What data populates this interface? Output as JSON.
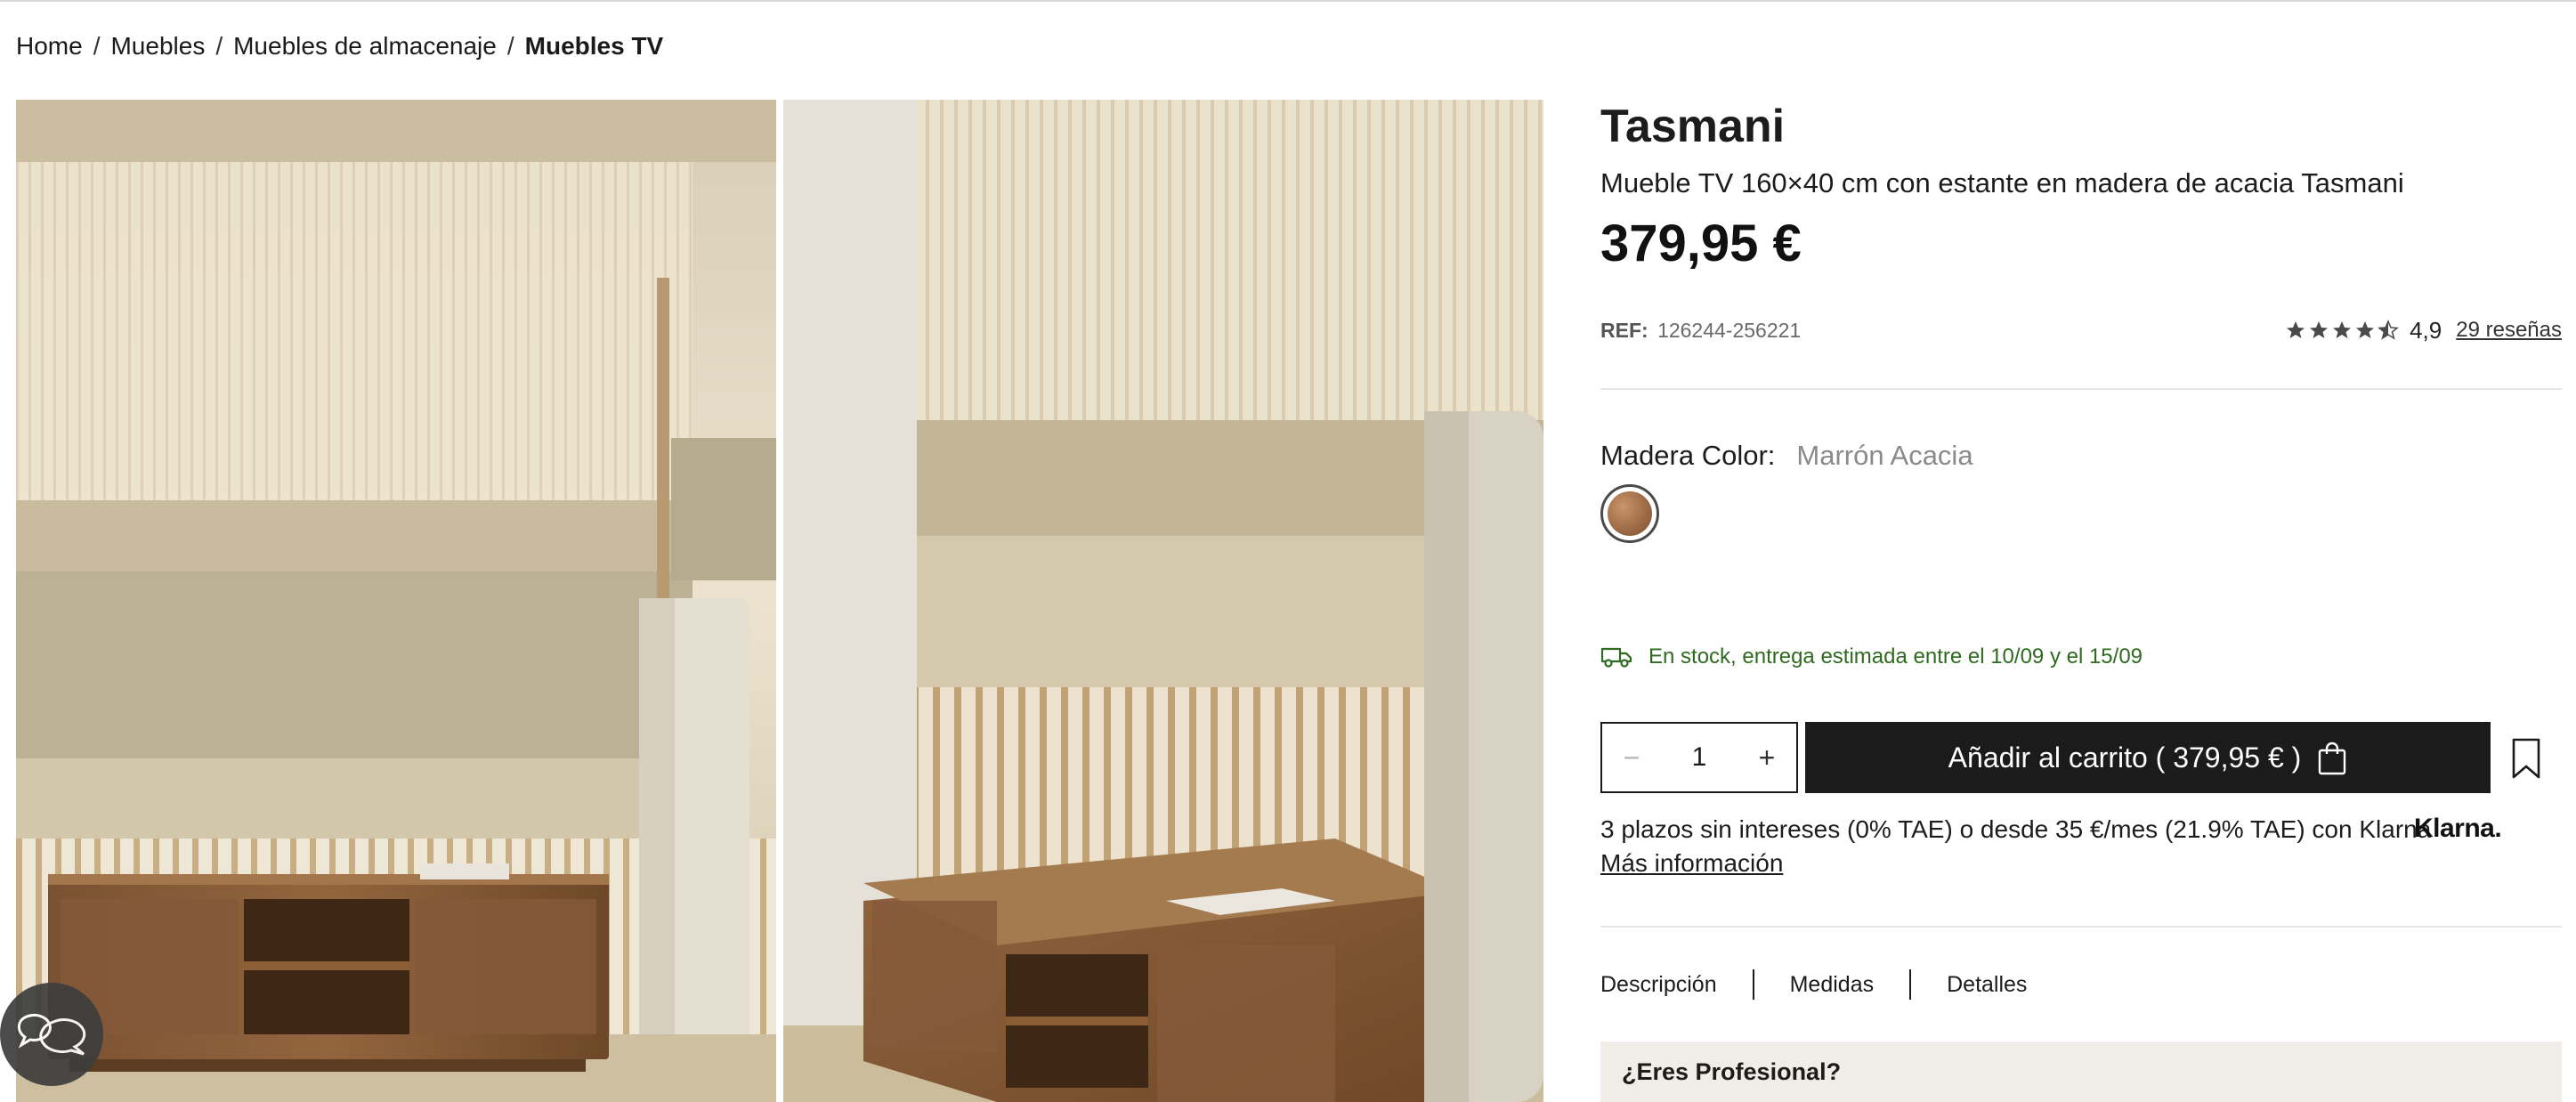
{
  "breadcrumb": {
    "items": [
      "Home",
      "Muebles",
      "Muebles de almacenaje"
    ],
    "current": "Muebles TV",
    "separator": "/"
  },
  "product": {
    "name": "Tasmani",
    "subtitle": "Mueble TV 160×40 cm con estante en madera de acacia Tasmani",
    "price": "379,95 €",
    "ref_label": "REF:",
    "ref_value": "126244-256221",
    "rating": {
      "stars": 4.5,
      "value": "4,9",
      "reviews": "29 reseñas"
    },
    "color": {
      "label": "Madera Color:",
      "value": "Marrón Acacia"
    },
    "stock": "En stock, entrega estimada entre el 10/09 y el 15/09",
    "quantity": "1",
    "add_to_cart": "Añadir al carrito ( 379,95 € )",
    "klarna": {
      "text": "3 plazos sin intereses (0% TAE) o desde 35 €/mes (21.9% TAE) con Klarna",
      "logo": "Klarna.",
      "more": "Más información"
    },
    "tabs": [
      "Descripción",
      "Medidas",
      "Detalles"
    ],
    "pro_box": "¿Eres Profesional?"
  },
  "icons": {
    "chat": "chat-bubbles-icon",
    "truck": "truck-icon",
    "bag": "shopping-bag-icon",
    "bookmark": "bookmark-icon",
    "star": "star-icon"
  },
  "colors": {
    "stock_green": "#2e6a1f",
    "button_dark": "#1b1b1b",
    "pro_box_bg": "#f0ede8"
  }
}
